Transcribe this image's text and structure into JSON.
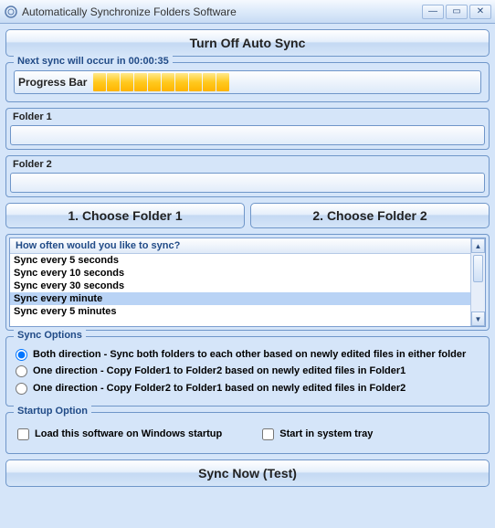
{
  "title": "Automatically Synchronize Folders Software",
  "turn_off_label": "Turn Off Auto Sync",
  "next_sync_label": "Next sync will occur in 00:00:35",
  "progress_label": "Progress Bar",
  "progress_blocks": 10,
  "folder1_label": "Folder 1",
  "folder1_value": "",
  "folder2_label": "Folder 2",
  "folder2_value": "",
  "choose1_label": "1. Choose Folder 1",
  "choose2_label": "2. Choose Folder 2",
  "list_header": "How often would you like to sync?",
  "list_items": [
    "Sync every 5 seconds",
    "Sync every 10 seconds",
    "Sync every 30 seconds",
    "Sync every minute",
    "Sync every 5 minutes"
  ],
  "list_selected_index": 3,
  "sync_options_legend": "Sync Options",
  "sync_options": [
    "Both direction - Sync both folders to each other based on newly edited files in either folder",
    "One direction - Copy Folder1 to Folder2 based on newly edited files in Folder1",
    "One direction - Copy Folder2 to Folder1 based on newly edited files in Folder2"
  ],
  "sync_selected_index": 0,
  "startup_legend": "Startup Option",
  "startup_load": "Load this software on Windows startup",
  "startup_tray": "Start in system tray",
  "sync_now_label": "Sync Now (Test)"
}
